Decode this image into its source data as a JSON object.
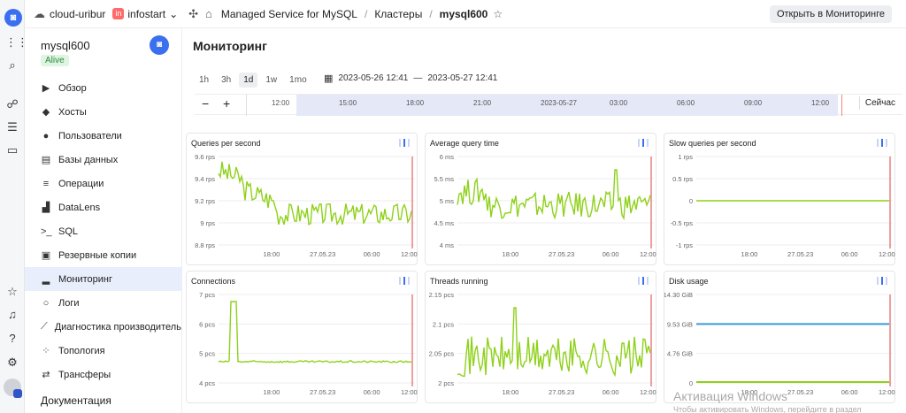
{
  "topbar": {
    "cloud": "cloud-uribur",
    "badge": "in",
    "folder": "infostart",
    "service": "Managed Service for MySQL",
    "crumb_clusters": "Кластеры",
    "crumb_current": "mysql600",
    "open_monitoring": "Открыть в Мониторинге"
  },
  "sidebar": {
    "cluster": "mysql600",
    "status": "Alive",
    "items": [
      {
        "label": "Обзор",
        "icon": "overview-icon",
        "glyph": "▶"
      },
      {
        "label": "Хосты",
        "icon": "hosts-icon",
        "glyph": "◆"
      },
      {
        "label": "Пользователи",
        "icon": "users-icon",
        "glyph": "●"
      },
      {
        "label": "Базы данных",
        "icon": "database-icon",
        "glyph": "▤"
      },
      {
        "label": "Операции",
        "icon": "operations-icon",
        "glyph": "≡"
      },
      {
        "label": "DataLens",
        "icon": "datalens-icon",
        "glyph": "▟"
      },
      {
        "label": "SQL",
        "icon": "sql-icon",
        "glyph": ">_"
      },
      {
        "label": "Резервные копии",
        "icon": "backup-icon",
        "glyph": "▣"
      },
      {
        "label": "Мониторинг",
        "icon": "monitoring-icon",
        "glyph": "▂"
      },
      {
        "label": "Логи",
        "icon": "logs-icon",
        "glyph": "○"
      },
      {
        "label": "Диагностика производитель...",
        "icon": "diagnostics-icon",
        "glyph": "⟋"
      },
      {
        "label": "Топология",
        "icon": "topology-icon",
        "glyph": "⁘"
      },
      {
        "label": "Трансферы",
        "icon": "transfers-icon",
        "glyph": "⇄"
      }
    ],
    "active_index": 8,
    "docs": "Документация"
  },
  "main": {
    "title": "Мониторинг",
    "ranges": [
      "1h",
      "3h",
      "1d",
      "1w",
      "1mo"
    ],
    "range_selected": "1d",
    "date_from": "2023-05-26 12:41",
    "date_to": "2023-05-27 12:41",
    "date_sep": "—",
    "timeline_ticks": [
      "12:00",
      "15:00",
      "18:00",
      "21:00",
      "2023-05-27",
      "03:00",
      "06:00",
      "09:00",
      "12:00"
    ],
    "now_label": "Сейчас",
    "zoom_out": "−",
    "zoom_in": "+"
  },
  "panels": [
    {
      "title": "Queries per second",
      "yticks": [
        "9.6 rps",
        "9.4 rps",
        "9.2 rps",
        "9 rps",
        "8.8 rps"
      ],
      "xticks": [
        "18:00",
        "27.05.23",
        "06:00",
        "12:00"
      ]
    },
    {
      "title": "Average query time",
      "yticks": [
        "6 ms",
        "5.5 ms",
        "5 ms",
        "4.5 ms",
        "4 ms"
      ],
      "xticks": [
        "18:00",
        "27.05.23",
        "06:00",
        "12:00"
      ]
    },
    {
      "title": "Slow queries per second",
      "yticks": [
        "1 rps",
        "0.5 rps",
        "0",
        "-0.5 rps",
        "-1 rps"
      ],
      "xticks": [
        "18:00",
        "27.05.23",
        "06:00",
        "12:00"
      ]
    },
    {
      "title": "Connections",
      "yticks": [
        "7 pcs",
        "6 pcs",
        "5 pcs",
        "4 pcs"
      ],
      "xticks": [
        "18:00",
        "27.05.23",
        "06:00",
        "12:00"
      ]
    },
    {
      "title": "Threads running",
      "yticks": [
        "2.15 pcs",
        "2.1 pcs",
        "2.05 pcs",
        "2 pcs"
      ],
      "xticks": [
        "18:00",
        "27.05.23",
        "06:00",
        "12:00"
      ]
    },
    {
      "title": "Disk usage",
      "yticks": [
        "14.30 GiB",
        "9.53 GiB",
        "4.76 GiB",
        "0"
      ],
      "xticks": [
        "18:00",
        "27.05.23",
        "06:00",
        "12:00"
      ]
    }
  ],
  "colors": {
    "accent": "#3a6ff0",
    "series_green": "#8ed11a",
    "series_blue": "#3a9ad9",
    "now_line": "#e88080"
  },
  "watermark": {
    "title": "Активация Windows",
    "sub": "Чтобы активировать Windows, перейдите в раздел"
  }
}
